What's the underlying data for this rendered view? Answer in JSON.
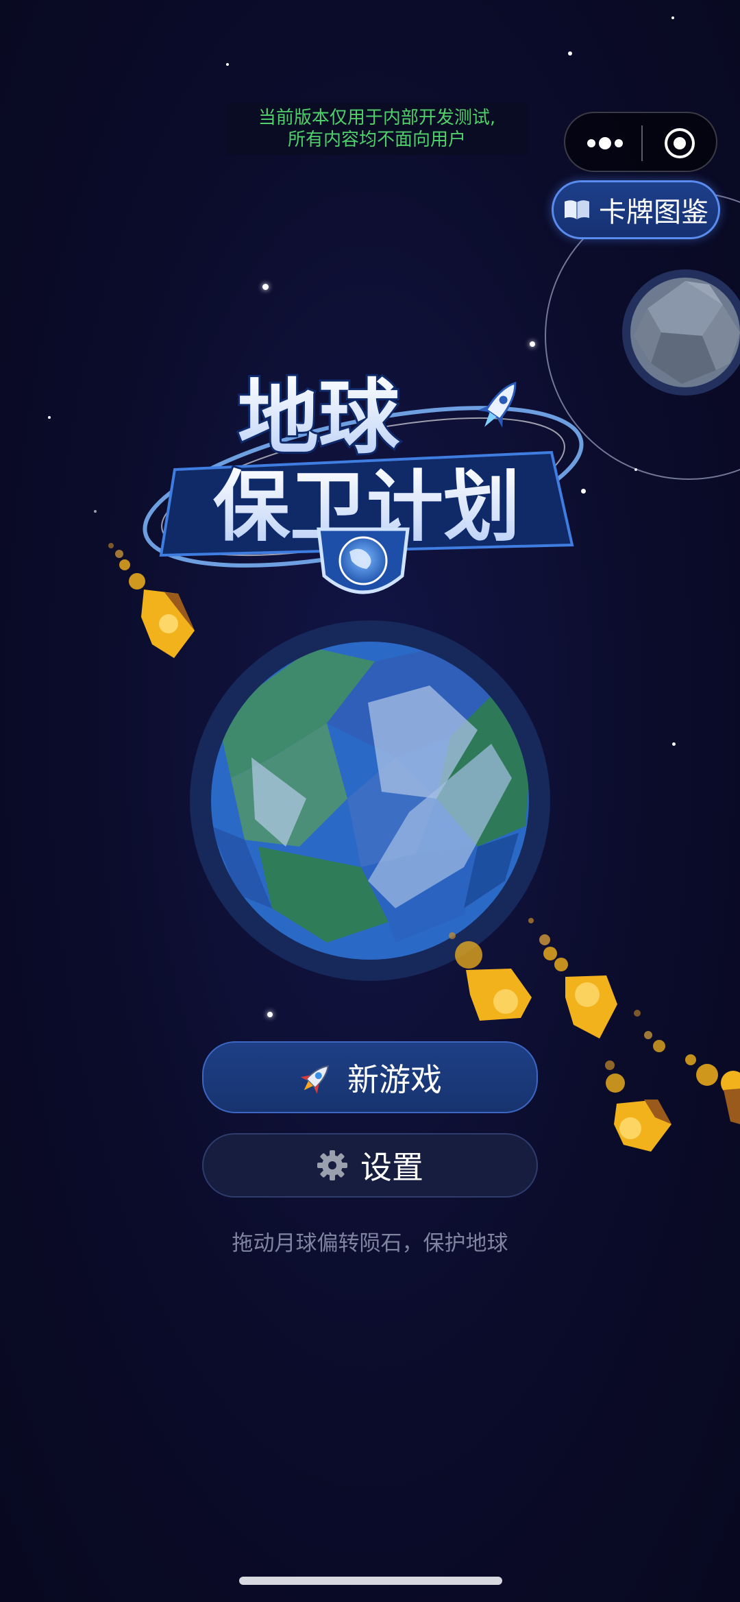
{
  "notice": {
    "line1": "当前版本仅用于内部开发测试,",
    "line2": "所有内容均不面向用户"
  },
  "capsule": {
    "more_icon": "more-dots-icon",
    "close_icon": "target-circle-icon"
  },
  "card_button": {
    "icon": "open-book-icon",
    "label": "卡牌图鉴"
  },
  "logo": {
    "title_line1": "地球",
    "title_line2": "保卫计划"
  },
  "buttons": {
    "new_game": {
      "icon": "rocket-icon",
      "label": "新游戏"
    },
    "settings": {
      "icon": "gear-icon",
      "label": "设置"
    }
  },
  "hint": "拖动月球偏转陨石，保护地球",
  "colors": {
    "background": "#0b0c2a",
    "notice_green": "#4fd06a",
    "button_blue": "#1e3f86",
    "accent_border": "#5a8cf0",
    "meteor_gold": "#f2b21c"
  }
}
